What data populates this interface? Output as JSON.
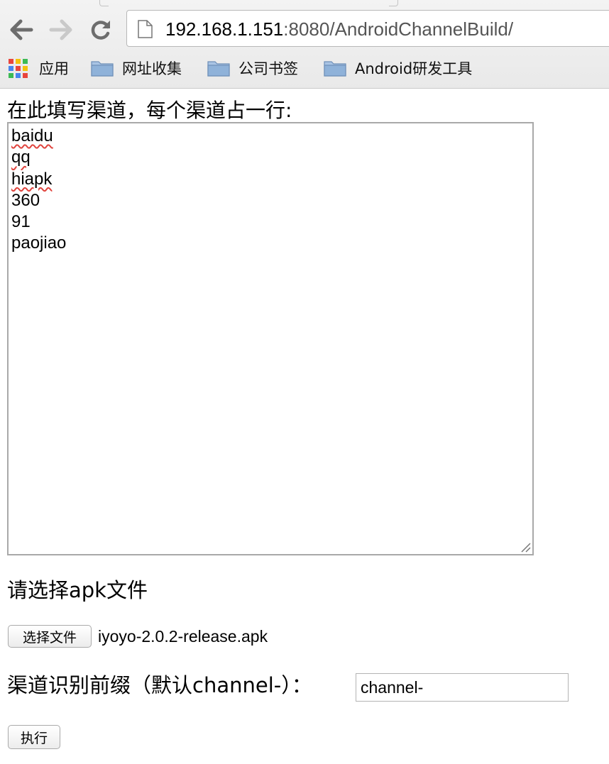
{
  "browser": {
    "url_host": "192.168.1.151",
    "url_path": ":8080/AndroidChannelBuild/",
    "bookmarks": [
      {
        "label": "应用",
        "icon": "apps-grid-icon"
      },
      {
        "label": "网址收集",
        "icon": "folder-icon"
      },
      {
        "label": "公司书签",
        "icon": "folder-icon"
      },
      {
        "label": "Android研发工具",
        "icon": "folder-icon"
      }
    ]
  },
  "form": {
    "channels_label": "在此填写渠道，每个渠道占一行:",
    "channels": [
      "baidu",
      "qq",
      "hiapk",
      "360",
      "91",
      "paojiao"
    ],
    "apk_label": "请选择apk文件",
    "choose_file_button": "选择文件",
    "file_name": "iyoyo-2.0.2-release.apk",
    "prefix_label": "渠道识别前缀（默认channel-）：",
    "prefix_value": "channel-",
    "run_button": "执行"
  },
  "colors": {
    "spellcheck": "#e0443e",
    "folder": "#8fb2d9"
  }
}
